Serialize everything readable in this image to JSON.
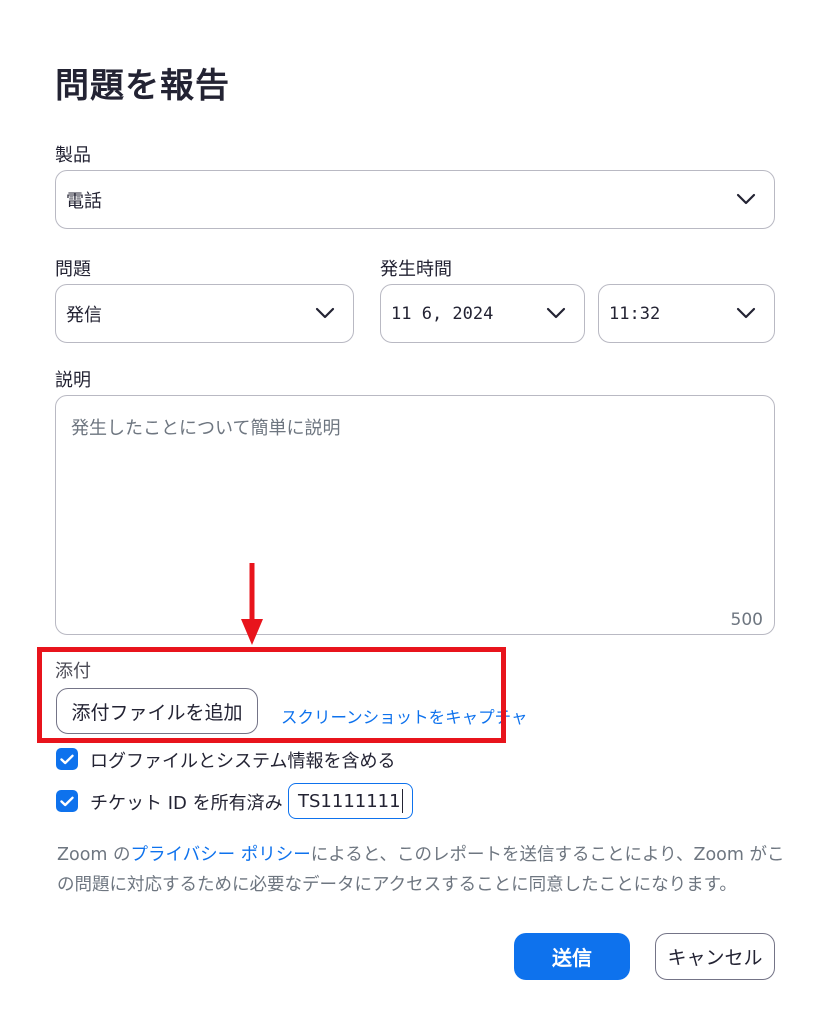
{
  "dialog": {
    "title": "問題を報告"
  },
  "product": {
    "label": "製品",
    "value": "電話"
  },
  "issue": {
    "label": "問題",
    "value": "発信"
  },
  "occurred": {
    "label": "発生時間",
    "date": "11 6, 2024",
    "time": "11:32"
  },
  "description": {
    "label": "説明",
    "placeholder": "発生したことについて簡単に説明",
    "counter": "500"
  },
  "attachment": {
    "label": "添付",
    "add_button": "添付ファイルを追加",
    "capture_link": "スクリーンショットをキャプチャ"
  },
  "options": {
    "include_logs": {
      "label": "ログファイルとシステム情報を含める",
      "checked": true
    },
    "has_ticket": {
      "label": "チケット ID を所有済み",
      "checked": true,
      "ticket_value": "TS1111111"
    }
  },
  "notice": {
    "prefix": "Zoom の",
    "policy_link": "プライバシー ポリシー",
    "suffix": "によると、このレポートを送信することにより、Zoom がこの問題に対応するために必要なデータにアクセスすることに同意したことになります。"
  },
  "actions": {
    "submit": "送信",
    "cancel": "キャンセル"
  },
  "colors": {
    "accent": "#0e72ed",
    "annotation": "#e8141c",
    "text": "#232333",
    "muted": "#6e7680"
  }
}
